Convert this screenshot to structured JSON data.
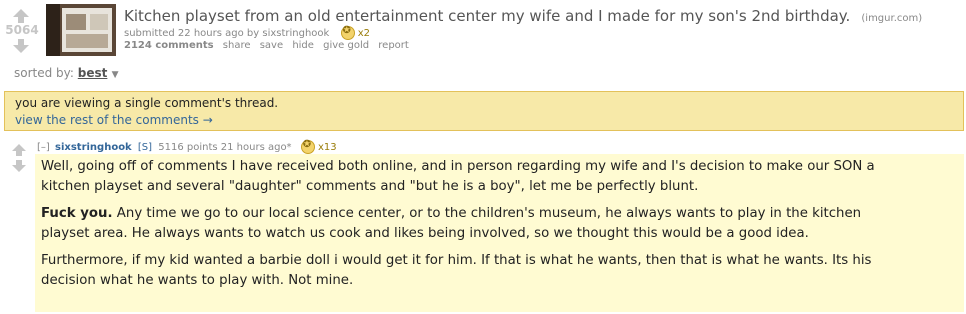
{
  "post": {
    "score": "5064",
    "title": "Kitchen playset from an old entertainment center my wife and I made for my son's 2nd birthday.",
    "domain": "(imgur.com)",
    "submitted_prefix": "submitted 22 hours ago by",
    "author": "sixstringhook",
    "gold_count": "x2",
    "comments_label": "2124 comments",
    "actions": [
      "share",
      "save",
      "hide",
      "give gold",
      "report"
    ]
  },
  "sort": {
    "label": "sorted by:",
    "value": "best"
  },
  "notice": {
    "line1": "you are viewing a single comment's thread.",
    "line2": "view the rest of the comments →"
  },
  "comment": {
    "collapse": "[–]",
    "author": "sixstringhook",
    "flair": "[S]",
    "points": "5116 points 21 hours ago*",
    "gold_count": "x13",
    "p1": "Well, going off of comments I have received both online, and in person regarding my wife and I's decision to make our SON a kitchen playset and several \"daughter\" comments and \"but he is a boy\", let me be perfectly blunt.",
    "p2_bold": "Fuck you.",
    "p2_rest": " Any time we go to our local science center, or to the children's museum, he always wants to play in the kitchen playset area. He always wants to watch us cook and likes being involved, so we thought this would be a good idea.",
    "p3": "Furthermore, if my kid wanted a barbie doll i would get it for him. If that is what he wants, then that is what he wants. Its his decision what he wants to play with. Not mine."
  },
  "colors": {
    "link": "#336699",
    "notice_bg": "#f7e9a8",
    "notice_border": "#e3c15a",
    "comment_bg": "#fffbd2",
    "arrow": "#c6c6c6"
  }
}
